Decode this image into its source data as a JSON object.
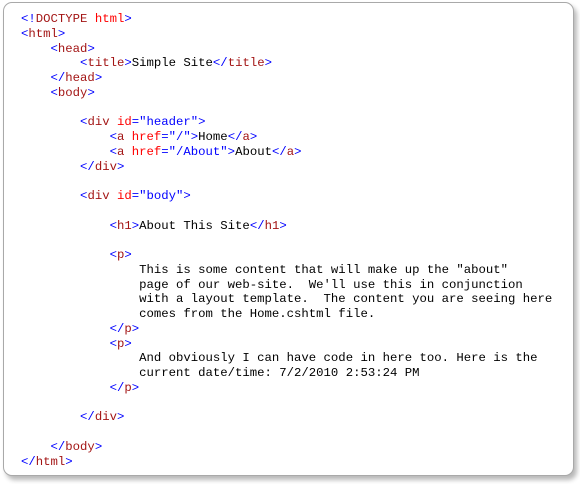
{
  "code_view": {
    "colors": {
      "blue": "#0000ff",
      "maroon": "#a31515",
      "red": "#ff0000",
      "black": "#000000"
    },
    "lines": [
      [
        [
          "blue",
          "<!"
        ],
        [
          "maroon",
          "DOCTYPE"
        ],
        [
          "black",
          " "
        ],
        [
          "red",
          "html"
        ],
        [
          "blue",
          ">"
        ]
      ],
      [
        [
          "blue",
          "<"
        ],
        [
          "maroon",
          "html"
        ],
        [
          "blue",
          ">"
        ]
      ],
      [
        [
          "black",
          "    "
        ],
        [
          "blue",
          "<"
        ],
        [
          "maroon",
          "head"
        ],
        [
          "blue",
          ">"
        ]
      ],
      [
        [
          "black",
          "        "
        ],
        [
          "blue",
          "<"
        ],
        [
          "maroon",
          "title"
        ],
        [
          "blue",
          ">"
        ],
        [
          "black",
          "Simple Site"
        ],
        [
          "blue",
          "</"
        ],
        [
          "maroon",
          "title"
        ],
        [
          "blue",
          ">"
        ]
      ],
      [
        [
          "black",
          "    "
        ],
        [
          "blue",
          "</"
        ],
        [
          "maroon",
          "head"
        ],
        [
          "blue",
          ">"
        ]
      ],
      [
        [
          "black",
          "    "
        ],
        [
          "blue",
          "<"
        ],
        [
          "maroon",
          "body"
        ],
        [
          "blue",
          ">"
        ]
      ],
      [],
      [
        [
          "black",
          "        "
        ],
        [
          "blue",
          "<"
        ],
        [
          "maroon",
          "div"
        ],
        [
          "black",
          " "
        ],
        [
          "red",
          "id"
        ],
        [
          "blue",
          "=\"header\">"
        ]
      ],
      [
        [
          "black",
          "            "
        ],
        [
          "blue",
          "<"
        ],
        [
          "maroon",
          "a"
        ],
        [
          "black",
          " "
        ],
        [
          "red",
          "href"
        ],
        [
          "blue",
          "=\"/\">"
        ],
        [
          "black",
          "Home"
        ],
        [
          "blue",
          "</"
        ],
        [
          "maroon",
          "a"
        ],
        [
          "blue",
          ">"
        ]
      ],
      [
        [
          "black",
          "            "
        ],
        [
          "blue",
          "<"
        ],
        [
          "maroon",
          "a"
        ],
        [
          "black",
          " "
        ],
        [
          "red",
          "href"
        ],
        [
          "blue",
          "=\"/About\">"
        ],
        [
          "black",
          "About"
        ],
        [
          "blue",
          "</"
        ],
        [
          "maroon",
          "a"
        ],
        [
          "blue",
          ">"
        ]
      ],
      [
        [
          "black",
          "        "
        ],
        [
          "blue",
          "</"
        ],
        [
          "maroon",
          "div"
        ],
        [
          "blue",
          ">"
        ]
      ],
      [],
      [
        [
          "black",
          "        "
        ],
        [
          "blue",
          "<"
        ],
        [
          "maroon",
          "div"
        ],
        [
          "black",
          " "
        ],
        [
          "red",
          "id"
        ],
        [
          "blue",
          "=\"body\">"
        ]
      ],
      [],
      [
        [
          "black",
          "            "
        ],
        [
          "blue",
          "<"
        ],
        [
          "maroon",
          "h1"
        ],
        [
          "blue",
          ">"
        ],
        [
          "black",
          "About This Site"
        ],
        [
          "blue",
          "</"
        ],
        [
          "maroon",
          "h1"
        ],
        [
          "blue",
          ">"
        ]
      ],
      [],
      [
        [
          "black",
          "            "
        ],
        [
          "blue",
          "<"
        ],
        [
          "maroon",
          "p"
        ],
        [
          "blue",
          ">"
        ]
      ],
      [
        [
          "black",
          "                This is some content that will make up the \"about\""
        ]
      ],
      [
        [
          "black",
          "                page of our web-site.  We'll use this in conjunction"
        ]
      ],
      [
        [
          "black",
          "                with a layout template.  The content you are seeing here"
        ]
      ],
      [
        [
          "black",
          "                comes from the Home.cshtml file."
        ]
      ],
      [
        [
          "black",
          "            "
        ],
        [
          "blue",
          "</"
        ],
        [
          "maroon",
          "p"
        ],
        [
          "blue",
          ">"
        ]
      ],
      [
        [
          "black",
          "            "
        ],
        [
          "blue",
          "<"
        ],
        [
          "maroon",
          "p"
        ],
        [
          "blue",
          ">"
        ]
      ],
      [
        [
          "black",
          "                And obviously I can have code in here too. Here is the"
        ]
      ],
      [
        [
          "black",
          "                current date/time: 7/2/2010 2:53:24 PM"
        ]
      ],
      [
        [
          "black",
          "            "
        ],
        [
          "blue",
          "</"
        ],
        [
          "maroon",
          "p"
        ],
        [
          "blue",
          ">"
        ]
      ],
      [],
      [
        [
          "black",
          "        "
        ],
        [
          "blue",
          "</"
        ],
        [
          "maroon",
          "div"
        ],
        [
          "blue",
          ">"
        ]
      ],
      [],
      [
        [
          "black",
          "    "
        ],
        [
          "blue",
          "</"
        ],
        [
          "maroon",
          "body"
        ],
        [
          "blue",
          ">"
        ]
      ],
      [
        [
          "blue",
          "</"
        ],
        [
          "maroon",
          "html"
        ],
        [
          "blue",
          ">"
        ]
      ]
    ]
  }
}
